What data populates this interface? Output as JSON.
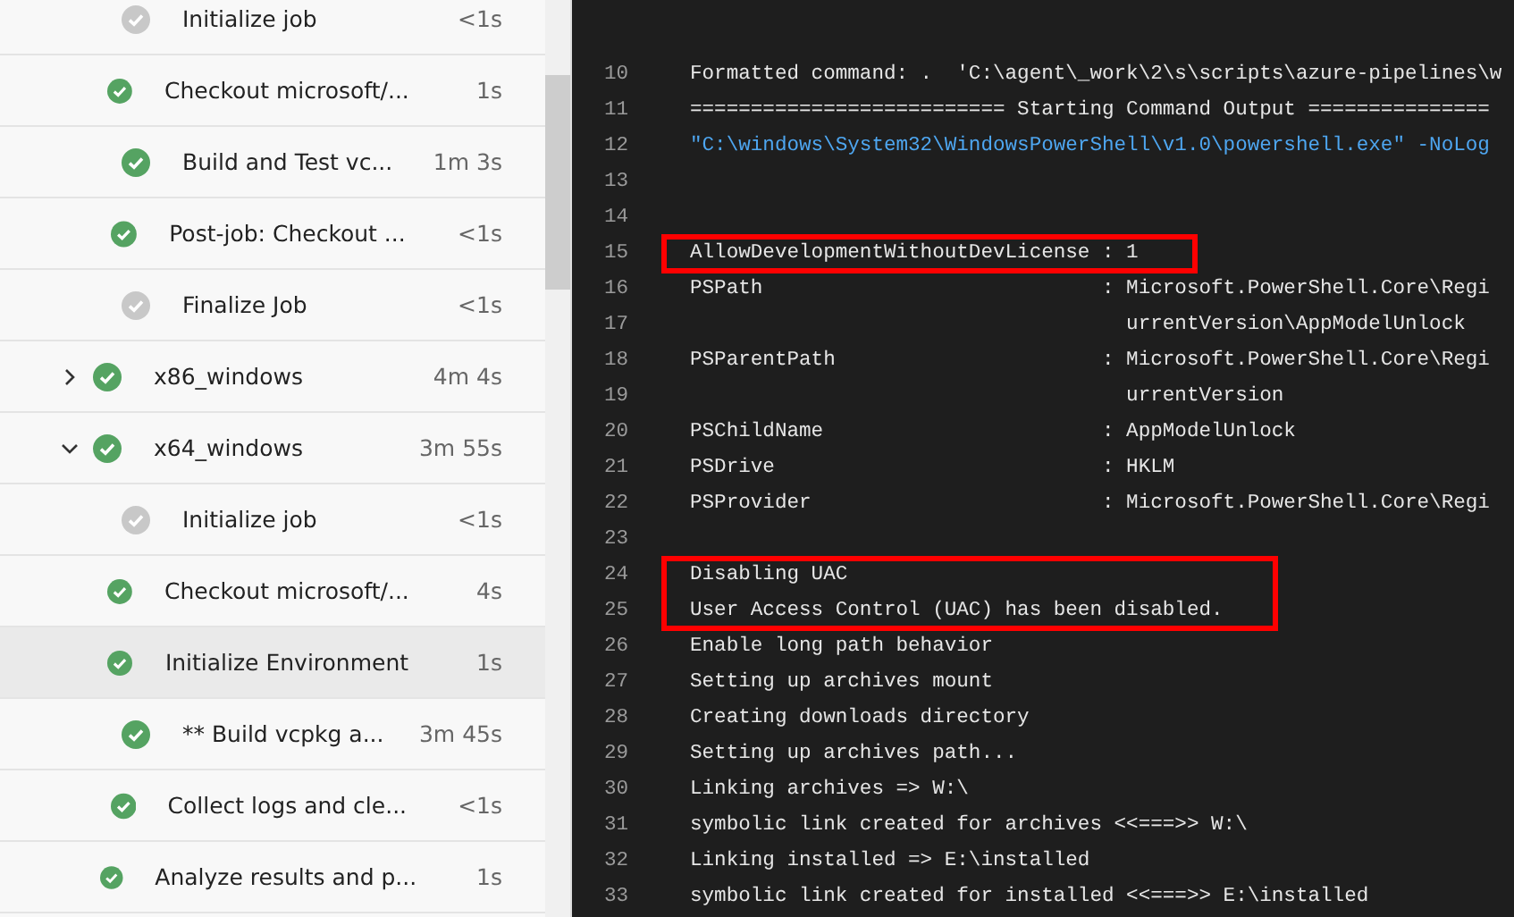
{
  "steps": [
    {
      "kind": "step",
      "name": "Initialize job",
      "skipped": true,
      "duration": "<1s",
      "selected": false
    },
    {
      "kind": "step",
      "name": "Checkout microsoft/...",
      "skipped": false,
      "duration": "1s",
      "selected": false
    },
    {
      "kind": "step",
      "name": "Build and Test vc...",
      "skipped": false,
      "duration": "1m 3s",
      "selected": false
    },
    {
      "kind": "step",
      "name": "Post-job: Checkout ...",
      "skipped": false,
      "duration": "<1s",
      "selected": false
    },
    {
      "kind": "step",
      "name": "Finalize Job",
      "skipped": true,
      "duration": "<1s",
      "selected": false
    },
    {
      "kind": "job",
      "name": "x86_windows",
      "skipped": false,
      "duration": "4m 4s",
      "selected": false,
      "expanded": false
    },
    {
      "kind": "job",
      "name": "x64_windows",
      "skipped": false,
      "duration": "3m 55s",
      "selected": false,
      "expanded": true
    },
    {
      "kind": "step",
      "name": "Initialize job",
      "skipped": true,
      "duration": "<1s",
      "selected": false
    },
    {
      "kind": "step",
      "name": "Checkout microsoft/...",
      "skipped": false,
      "duration": "4s",
      "selected": false
    },
    {
      "kind": "step",
      "name": "Initialize Environment",
      "skipped": false,
      "duration": "1s",
      "selected": true
    },
    {
      "kind": "step",
      "name": "** Build vcpkg a...",
      "skipped": false,
      "duration": "3m 45s",
      "selected": false
    },
    {
      "kind": "step",
      "name": "Collect logs and cle...",
      "skipped": false,
      "duration": "<1s",
      "selected": false
    },
    {
      "kind": "step",
      "name": "Analyze results and p...",
      "skipped": false,
      "duration": "1s",
      "selected": false
    }
  ],
  "log": {
    "lines": [
      {
        "number": "10",
        "text": "Formatted command: .  'C:\\agent\\_work\\2\\s\\scripts\\azure-pipelines\\w",
        "kind": "plain"
      },
      {
        "number": "11",
        "text": "========================== Starting Command Output ===============",
        "kind": "plain"
      },
      {
        "number": "12",
        "text": "\"C:\\windows\\System32\\WindowsPowerShell\\v1.0\\powershell.exe\" -NoLog",
        "kind": "command"
      },
      {
        "number": "13"
      },
      {
        "number": "14"
      },
      {
        "number": "15",
        "text": "AllowDevelopmentWithoutDevLicense : 1",
        "kind": "plain"
      },
      {
        "number": "16",
        "text": "PSPath                            : Microsoft.PowerShell.Core\\Regi",
        "kind": "plain"
      },
      {
        "number": "17",
        "text": "                                    urrentVersion\\AppModelUnlock",
        "kind": "plain"
      },
      {
        "number": "18",
        "text": "PSParentPath                      : Microsoft.PowerShell.Core\\Regi",
        "kind": "plain"
      },
      {
        "number": "19",
        "text": "                                    urrentVersion",
        "kind": "plain"
      },
      {
        "number": "20",
        "text": "PSChildName                       : AppModelUnlock",
        "kind": "plain"
      },
      {
        "number": "21",
        "text": "PSDrive                           : HKLM",
        "kind": "plain"
      },
      {
        "number": "22",
        "text": "PSProvider                        : Microsoft.PowerShell.Core\\Regi",
        "kind": "plain"
      },
      {
        "number": "23"
      },
      {
        "number": "24",
        "text": "Disabling UAC",
        "kind": "plain"
      },
      {
        "number": "25",
        "text": "User Access Control (UAC) has been disabled.",
        "kind": "plain"
      },
      {
        "number": "26",
        "text": "Enable long path behavior",
        "kind": "plain"
      },
      {
        "number": "27",
        "text": "Setting up archives mount",
        "kind": "plain"
      },
      {
        "number": "28",
        "text": "Creating downloads directory",
        "kind": "plain"
      },
      {
        "number": "29",
        "text": "Setting up archives path...",
        "kind": "plain"
      },
      {
        "number": "30",
        "text": "Linking archives => W:\\",
        "kind": "plain"
      },
      {
        "number": "31",
        "text": "symbolic link created for archives <<===>> W:\\",
        "kind": "plain"
      },
      {
        "number": "32",
        "text": "Linking installed => E:\\installed",
        "kind": "plain"
      },
      {
        "number": "33",
        "text": "symbolic link created for installed <<===>> E:\\installed",
        "kind": "plain"
      }
    ]
  }
}
